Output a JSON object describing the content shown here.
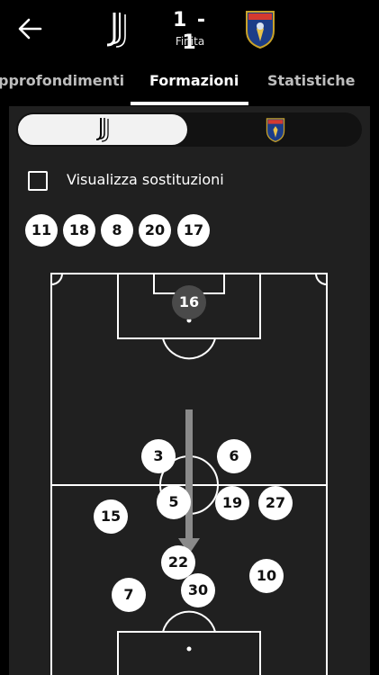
{
  "header": {
    "score": "1 - 1",
    "status": "Finita",
    "home_logo_name": "juventus-logo",
    "away_logo_name": "lecce-logo"
  },
  "tabs": [
    {
      "label": "pprofondimenti"
    },
    {
      "label": "Formazioni"
    },
    {
      "label": "Statistiche"
    }
  ],
  "controls": {
    "show_substitutions_label": "Visualizza sostituzioni"
  },
  "substitutes": [
    "11",
    "18",
    "8",
    "20",
    "17"
  ],
  "players": {
    "gk": "16",
    "p3": "3",
    "p6": "6",
    "p5": "5",
    "p19": "19",
    "p27": "27",
    "p15": "15",
    "p22": "22",
    "p10": "10",
    "p7": "7",
    "p30": "30"
  },
  "colors": {
    "background": "#000000",
    "panel": "#202020",
    "accent": "#ffffff"
  }
}
